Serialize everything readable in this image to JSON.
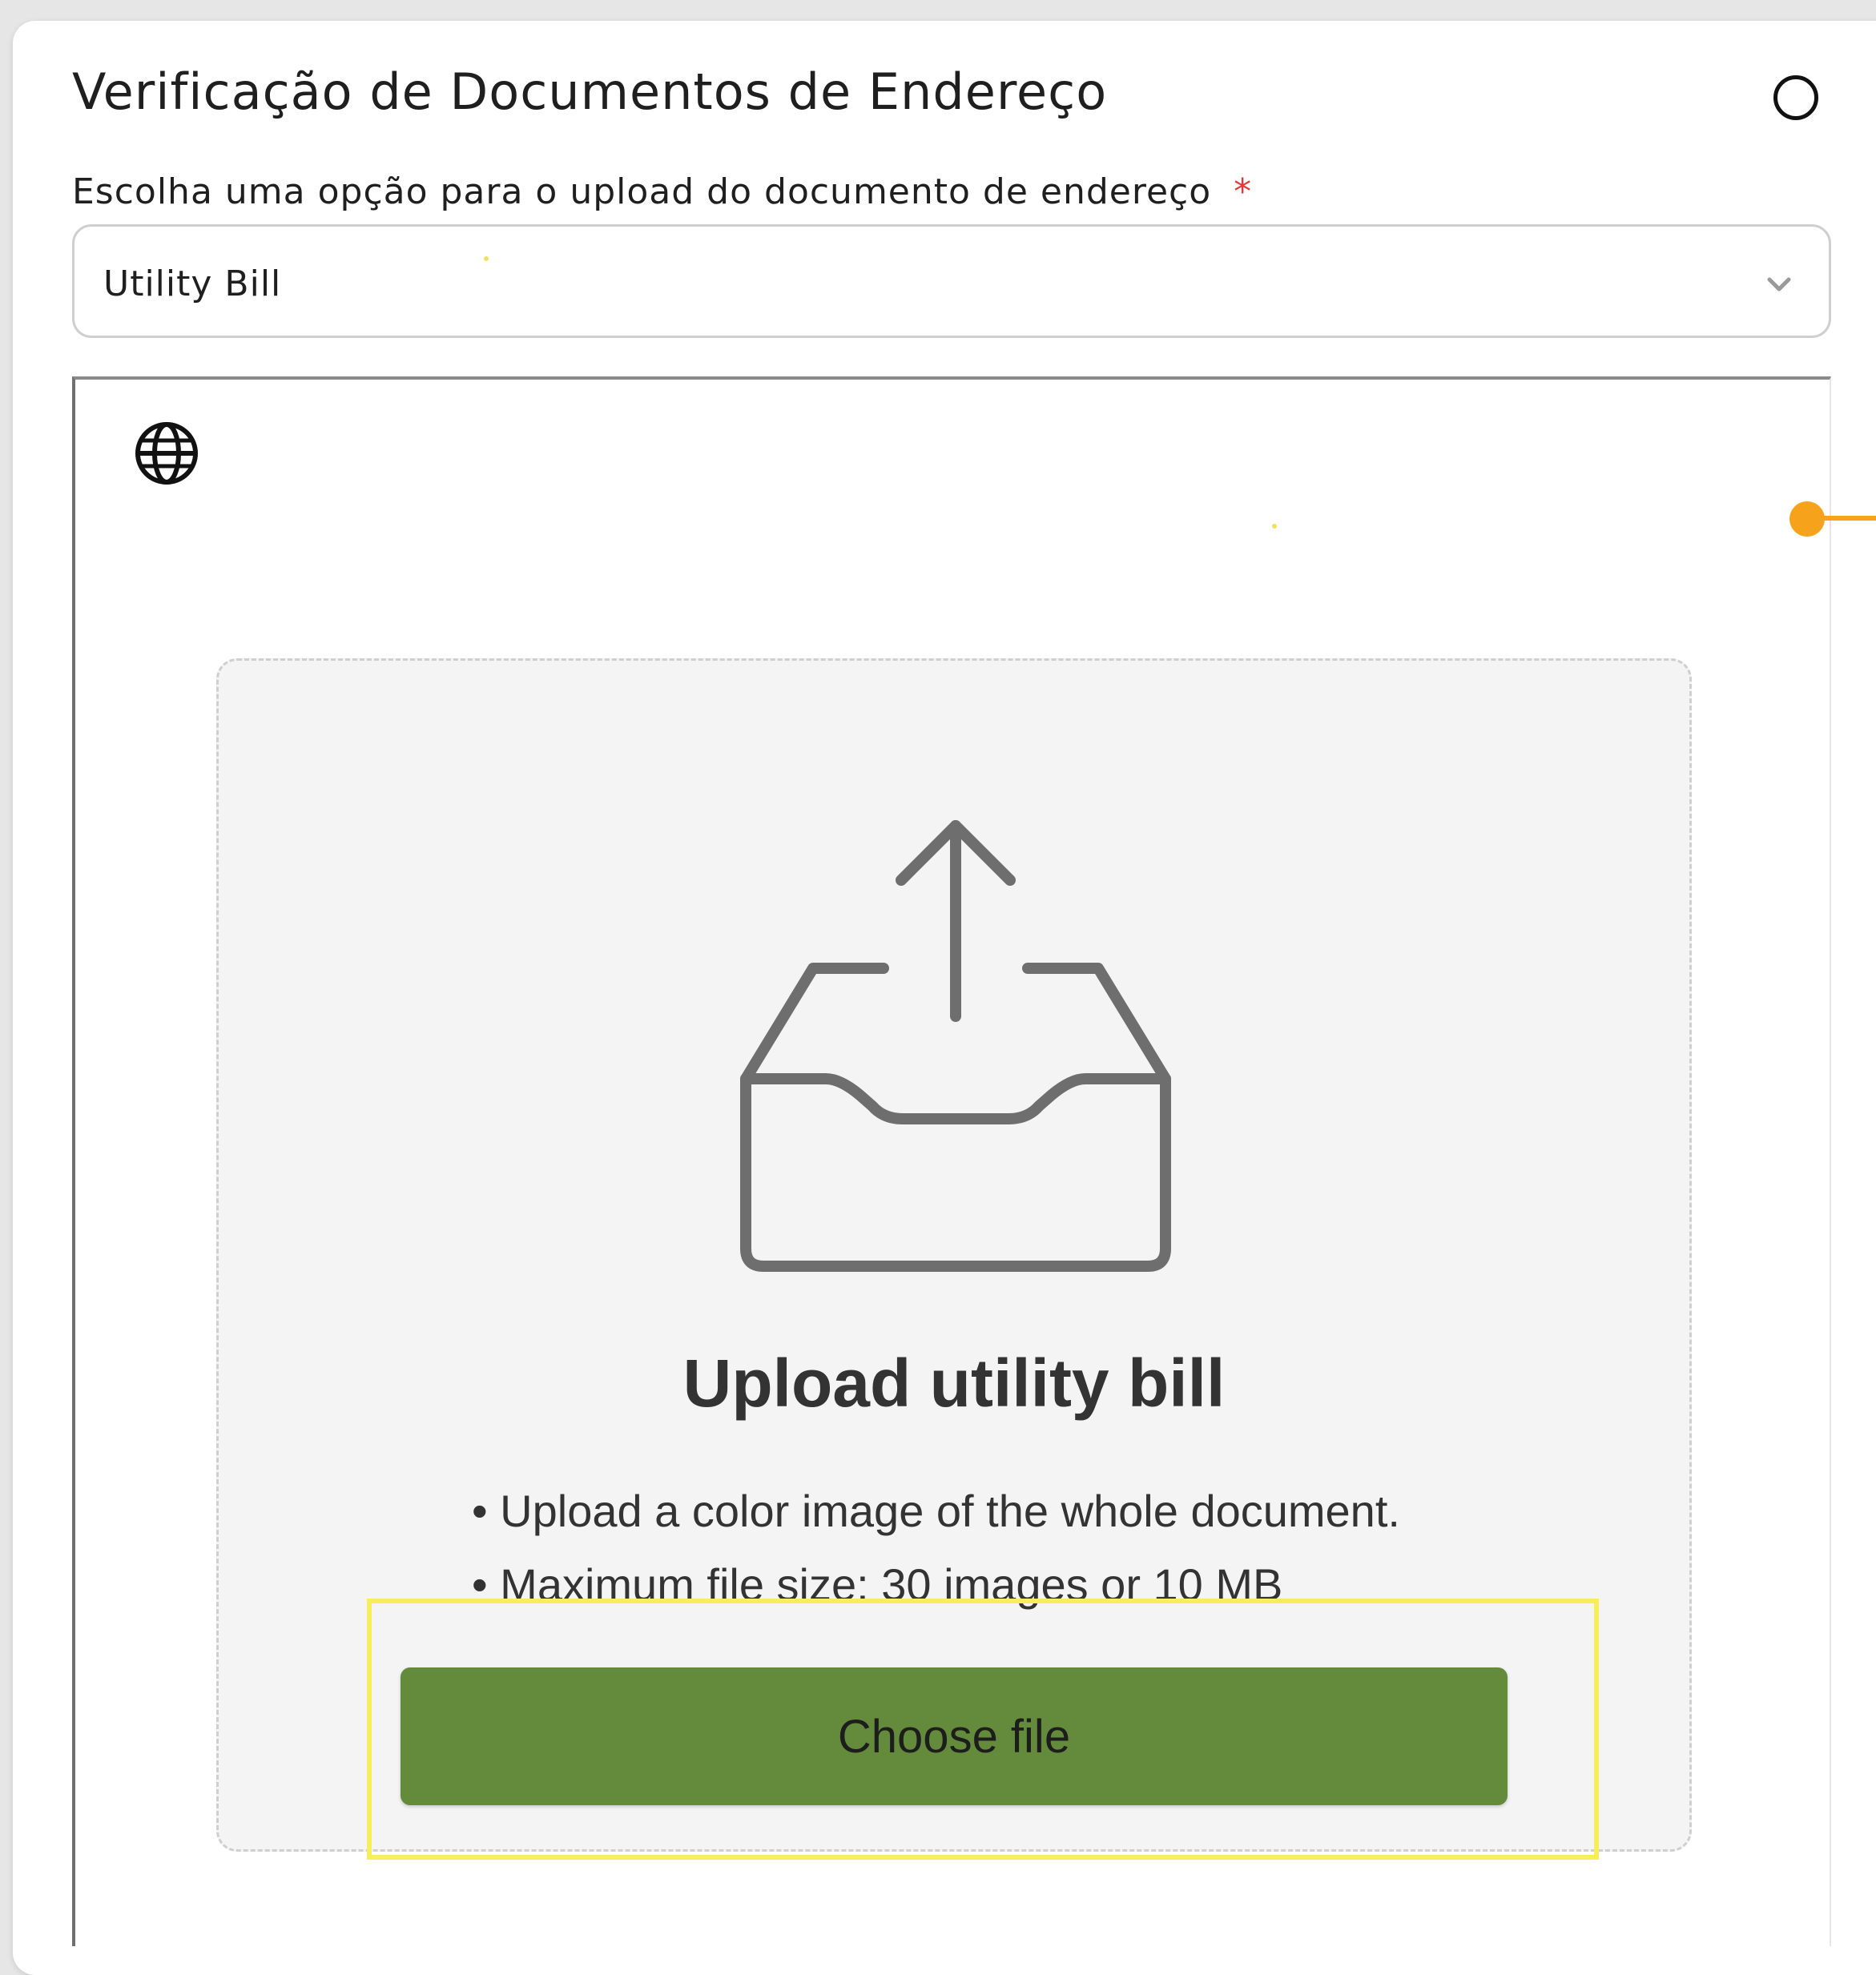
{
  "dialog": {
    "title": "Verificação de Documentos de Endereço",
    "close_icon": "circle-icon"
  },
  "document_select": {
    "label": "Escolha uma opção para o upload do documento de endereço",
    "required_mark": "*",
    "value": "Utility Bill",
    "chevron_icon": "chevron-down-icon"
  },
  "upload": {
    "language_icon": "globe-icon",
    "tray_icon": "upload-tray-icon",
    "title": "Upload utility bill",
    "rules": [
      "• Upload a color image of the whole document.",
      "• Maximum file size: 30 images or 10 MB"
    ],
    "button_label": "Choose file"
  },
  "colors": {
    "accent": "#648b3b",
    "required": "#e03b3b",
    "highlight": "#f8ee5c",
    "marker": "#f7a21b"
  }
}
